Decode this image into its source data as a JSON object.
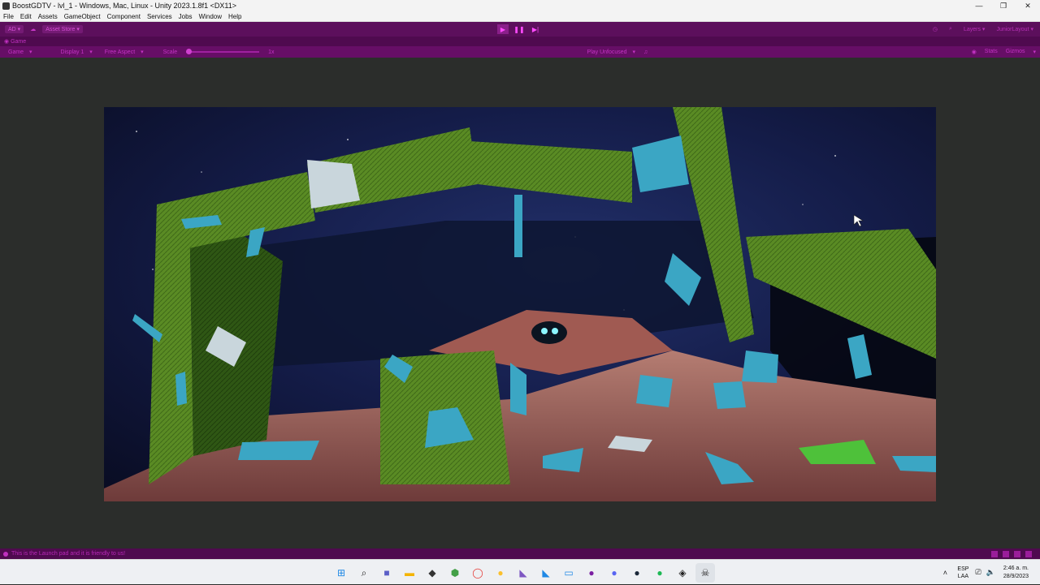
{
  "window": {
    "title": "BoostGDTV - lvl_1 - Windows, Mac, Linux - Unity 2023.1.8f1 <DX11>",
    "controls": [
      "minimize",
      "restore",
      "close"
    ]
  },
  "menu": [
    "File",
    "Edit",
    "Assets",
    "GameObject",
    "Component",
    "Services",
    "Jobs",
    "Window",
    "Help"
  ],
  "toolbar": {
    "account": "AD",
    "asset_store": "Asset Store",
    "layers": "Layers",
    "layout": "JuniorLayout"
  },
  "tab": {
    "label": "Game"
  },
  "game_toolbar": {
    "mode": "Game",
    "display": "Display 1",
    "aspect": "Free Aspect",
    "scale_label": "Scale",
    "scale_value": "1x",
    "play_mode": "Play Unfocused",
    "stats": "Stats",
    "gizmos": "Gizmos"
  },
  "status": {
    "message": "This is the Launch pad and it is friendly to us!"
  },
  "taskbar": {
    "apps": [
      "windows-start",
      "search",
      "teams-meet",
      "file-explorer",
      "unity-hub",
      "brave",
      "opera",
      "chrome",
      "visual-studio",
      "vscode",
      "app-bar",
      "github-desktop",
      "discord",
      "steam",
      "spotify",
      "unity",
      "skull-game"
    ],
    "lang_top": "ESP",
    "lang_bottom": "LAA",
    "time": "2:46 a. m.",
    "date": "28/9/2023"
  },
  "colors": {
    "editor_tint": "#660e66",
    "panel_bg": "#2b2d2b",
    "green_block": "#4e7d1f",
    "crystal": "#3ba6c4",
    "floor": "#8a5550"
  }
}
